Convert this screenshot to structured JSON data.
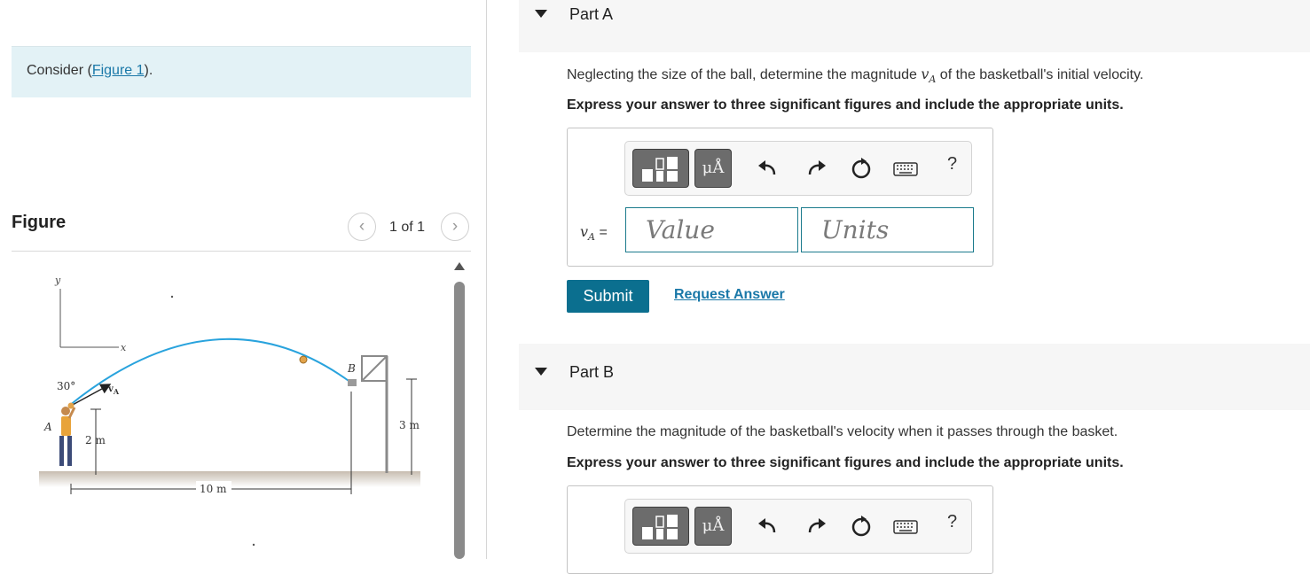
{
  "intro": {
    "consider_prefix": "Consider (",
    "figure_link": "Figure 1",
    "consider_suffix": ")."
  },
  "figure_panel": {
    "heading": "Figure",
    "pager_text": "1 of 1",
    "prev_icon": "chevron-left-icon",
    "next_icon": "chevron-right-icon",
    "labels": {
      "y_axis": "y",
      "x_axis": "x",
      "angle": "30°",
      "velocity_v": "v",
      "velocity_sub": "A",
      "point_a": "A",
      "point_b": "B",
      "height_launch": "2 m",
      "height_basket": "3 m",
      "distance": "10 m"
    },
    "colors": {
      "trajectory": "#29a3dd",
      "ball": "#e2a34a",
      "ground": "#c9bfb3"
    }
  },
  "part_a": {
    "title": "Part A",
    "question_prefix": "Neglecting the size of the ball, determine the magnitude ",
    "var_letter": "v",
    "var_sub": "A",
    "question_suffix": " of the basketball's initial velocity.",
    "instruction": "Express your answer to three significant figures and include the appropriate units.",
    "toolbar": {
      "units_button": "μÅ",
      "icons": [
        "templates-icon",
        "units-icon",
        "undo-icon",
        "redo-icon",
        "reset-icon",
        "keyboard-icon",
        "help-icon"
      ],
      "help": "?"
    },
    "eq_var": "v",
    "eq_sub": "A",
    "eq_sign": "=",
    "value_placeholder": "Value",
    "units_placeholder": "Units",
    "submit_label": "Submit",
    "request_label": "Request Answer"
  },
  "part_b": {
    "title": "Part B",
    "question": "Determine the magnitude of the basketball's velocity when it passes through the basket.",
    "instruction": "Express your answer to three significant figures and include the appropriate units.",
    "toolbar": {
      "units_button": "μÅ",
      "help": "?"
    }
  },
  "colors": {
    "accent": "#0b6f8f",
    "link": "#1a78a8",
    "consider_bg": "#e3f2f6",
    "part_header_bg": "#f6f6f6",
    "input_border": "#1a7a8c"
  }
}
